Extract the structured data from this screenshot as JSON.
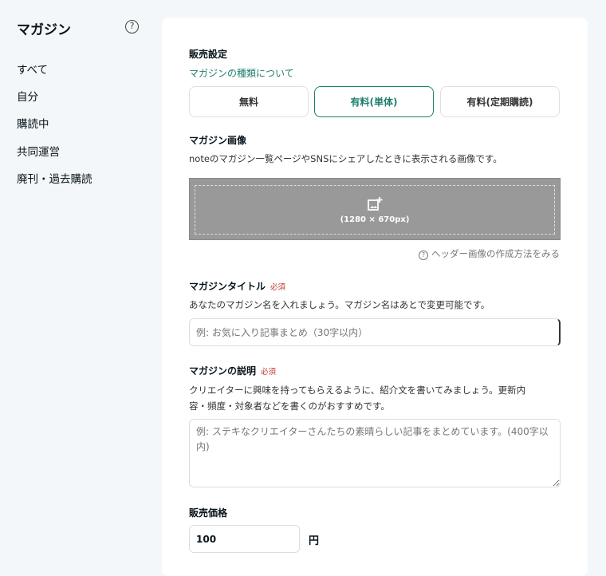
{
  "sidebar": {
    "title": "マガジン",
    "items": [
      "すべて",
      "自分",
      "購読中",
      "共同運営",
      "廃刊・過去購読"
    ]
  },
  "form": {
    "sales_heading": "販売設定",
    "type_link": "マガジンの種類について",
    "options": [
      "無料",
      "有料(単体)",
      "有料(定期購読)"
    ],
    "selected_option": "有料(単体)",
    "image_heading": "マガジン画像",
    "image_desc": "noteのマガジン一覧ページやSNSにシェアしたときに表示される画像です。",
    "image_size": "(1280 × 670px)",
    "header_help": "ヘッダー画像の作成方法をみる",
    "title_heading": "マガジンタイトル",
    "required": "必須",
    "title_desc": "あなたのマガジン名を入れましょう。マガジン名はあとで変更可能です。",
    "title_placeholder": "例: お気に入り記事まとめ（30字以内）",
    "desc_heading": "マガジンの説明",
    "desc_desc": "クリエイターに興味を持ってもらえるように、紹介文を書いてみましょう。更新内容・頻度・対象者などを書くのがおすすめです。",
    "desc_placeholder": "例: ステキなクリエイターさんたちの素晴らしい記事をまとめています。(400字以内)",
    "price_heading": "販売価格",
    "price_value": "100",
    "currency": "円"
  }
}
